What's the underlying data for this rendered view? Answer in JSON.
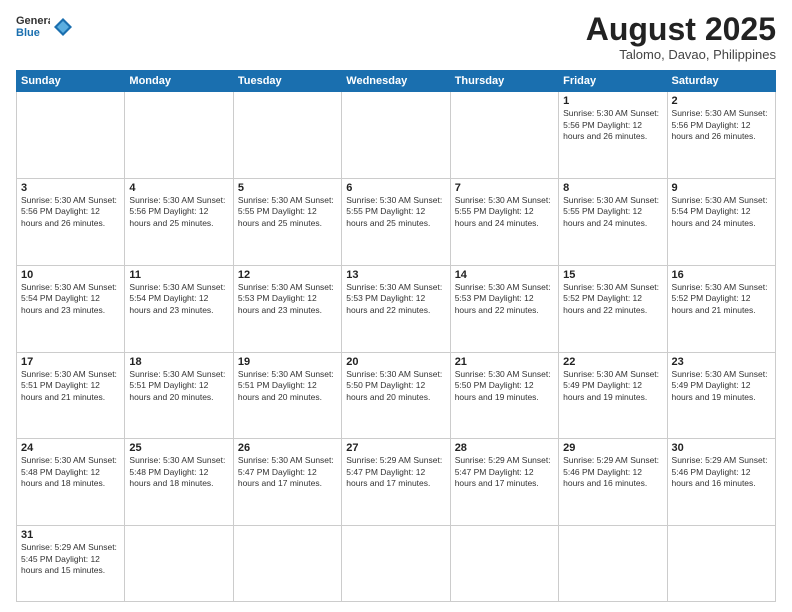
{
  "header": {
    "logo_general": "General",
    "logo_blue": "Blue",
    "month_title": "August 2025",
    "subtitle": "Talomo, Davao, Philippines"
  },
  "weekdays": [
    "Sunday",
    "Monday",
    "Tuesday",
    "Wednesday",
    "Thursday",
    "Friday",
    "Saturday"
  ],
  "weeks": [
    [
      {
        "day": "",
        "info": ""
      },
      {
        "day": "",
        "info": ""
      },
      {
        "day": "",
        "info": ""
      },
      {
        "day": "",
        "info": ""
      },
      {
        "day": "",
        "info": ""
      },
      {
        "day": "1",
        "info": "Sunrise: 5:30 AM\nSunset: 5:56 PM\nDaylight: 12 hours and 26 minutes."
      },
      {
        "day": "2",
        "info": "Sunrise: 5:30 AM\nSunset: 5:56 PM\nDaylight: 12 hours and 26 minutes."
      }
    ],
    [
      {
        "day": "3",
        "info": "Sunrise: 5:30 AM\nSunset: 5:56 PM\nDaylight: 12 hours and 26 minutes."
      },
      {
        "day": "4",
        "info": "Sunrise: 5:30 AM\nSunset: 5:56 PM\nDaylight: 12 hours and 25 minutes."
      },
      {
        "day": "5",
        "info": "Sunrise: 5:30 AM\nSunset: 5:55 PM\nDaylight: 12 hours and 25 minutes."
      },
      {
        "day": "6",
        "info": "Sunrise: 5:30 AM\nSunset: 5:55 PM\nDaylight: 12 hours and 25 minutes."
      },
      {
        "day": "7",
        "info": "Sunrise: 5:30 AM\nSunset: 5:55 PM\nDaylight: 12 hours and 24 minutes."
      },
      {
        "day": "8",
        "info": "Sunrise: 5:30 AM\nSunset: 5:55 PM\nDaylight: 12 hours and 24 minutes."
      },
      {
        "day": "9",
        "info": "Sunrise: 5:30 AM\nSunset: 5:54 PM\nDaylight: 12 hours and 24 minutes."
      }
    ],
    [
      {
        "day": "10",
        "info": "Sunrise: 5:30 AM\nSunset: 5:54 PM\nDaylight: 12 hours and 23 minutes."
      },
      {
        "day": "11",
        "info": "Sunrise: 5:30 AM\nSunset: 5:54 PM\nDaylight: 12 hours and 23 minutes."
      },
      {
        "day": "12",
        "info": "Sunrise: 5:30 AM\nSunset: 5:53 PM\nDaylight: 12 hours and 23 minutes."
      },
      {
        "day": "13",
        "info": "Sunrise: 5:30 AM\nSunset: 5:53 PM\nDaylight: 12 hours and 22 minutes."
      },
      {
        "day": "14",
        "info": "Sunrise: 5:30 AM\nSunset: 5:53 PM\nDaylight: 12 hours and 22 minutes."
      },
      {
        "day": "15",
        "info": "Sunrise: 5:30 AM\nSunset: 5:52 PM\nDaylight: 12 hours and 22 minutes."
      },
      {
        "day": "16",
        "info": "Sunrise: 5:30 AM\nSunset: 5:52 PM\nDaylight: 12 hours and 21 minutes."
      }
    ],
    [
      {
        "day": "17",
        "info": "Sunrise: 5:30 AM\nSunset: 5:51 PM\nDaylight: 12 hours and 21 minutes."
      },
      {
        "day": "18",
        "info": "Sunrise: 5:30 AM\nSunset: 5:51 PM\nDaylight: 12 hours and 20 minutes."
      },
      {
        "day": "19",
        "info": "Sunrise: 5:30 AM\nSunset: 5:51 PM\nDaylight: 12 hours and 20 minutes."
      },
      {
        "day": "20",
        "info": "Sunrise: 5:30 AM\nSunset: 5:50 PM\nDaylight: 12 hours and 20 minutes."
      },
      {
        "day": "21",
        "info": "Sunrise: 5:30 AM\nSunset: 5:50 PM\nDaylight: 12 hours and 19 minutes."
      },
      {
        "day": "22",
        "info": "Sunrise: 5:30 AM\nSunset: 5:49 PM\nDaylight: 12 hours and 19 minutes."
      },
      {
        "day": "23",
        "info": "Sunrise: 5:30 AM\nSunset: 5:49 PM\nDaylight: 12 hours and 19 minutes."
      }
    ],
    [
      {
        "day": "24",
        "info": "Sunrise: 5:30 AM\nSunset: 5:48 PM\nDaylight: 12 hours and 18 minutes."
      },
      {
        "day": "25",
        "info": "Sunrise: 5:30 AM\nSunset: 5:48 PM\nDaylight: 12 hours and 18 minutes."
      },
      {
        "day": "26",
        "info": "Sunrise: 5:30 AM\nSunset: 5:47 PM\nDaylight: 12 hours and 17 minutes."
      },
      {
        "day": "27",
        "info": "Sunrise: 5:29 AM\nSunset: 5:47 PM\nDaylight: 12 hours and 17 minutes."
      },
      {
        "day": "28",
        "info": "Sunrise: 5:29 AM\nSunset: 5:47 PM\nDaylight: 12 hours and 17 minutes."
      },
      {
        "day": "29",
        "info": "Sunrise: 5:29 AM\nSunset: 5:46 PM\nDaylight: 12 hours and 16 minutes."
      },
      {
        "day": "30",
        "info": "Sunrise: 5:29 AM\nSunset: 5:46 PM\nDaylight: 12 hours and 16 minutes."
      }
    ],
    [
      {
        "day": "31",
        "info": "Sunrise: 5:29 AM\nSunset: 5:45 PM\nDaylight: 12 hours and 15 minutes."
      },
      {
        "day": "",
        "info": ""
      },
      {
        "day": "",
        "info": ""
      },
      {
        "day": "",
        "info": ""
      },
      {
        "day": "",
        "info": ""
      },
      {
        "day": "",
        "info": ""
      },
      {
        "day": "",
        "info": ""
      }
    ]
  ]
}
